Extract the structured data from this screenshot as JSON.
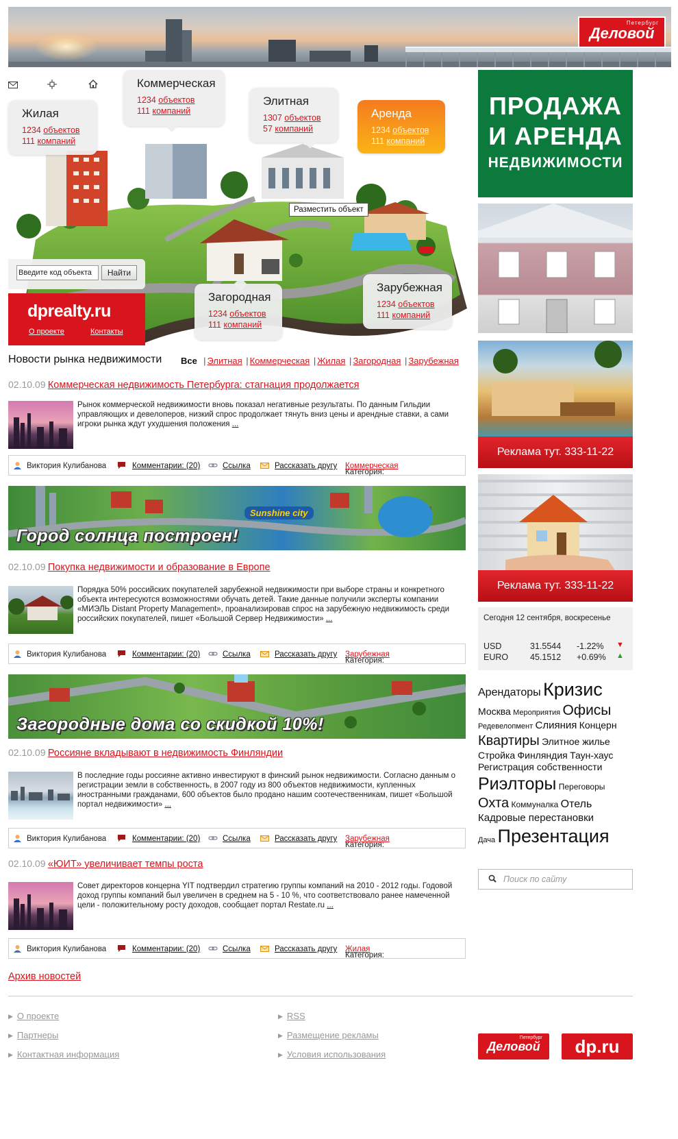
{
  "header": {
    "logo_small": "Петербург",
    "logo_big": "Деловой"
  },
  "top_icons": [
    "mail-icon",
    "sitemap-icon",
    "home-icon"
  ],
  "categories": {
    "residential": {
      "title": "Жилая",
      "objects_count": "1234",
      "objects_label": "объектов",
      "companies_count": "111",
      "companies_label": "компаний"
    },
    "commercial": {
      "title": "Коммерческая",
      "objects_count": "1234",
      "objects_label": "объектов",
      "companies_count": "111",
      "companies_label": "компаний"
    },
    "elite": {
      "title": "Элитная",
      "objects_count": "1307",
      "objects_label": "объектов",
      "companies_count": "57",
      "companies_label": "компаний"
    },
    "rent": {
      "title": "Аренда",
      "objects_count": "1234",
      "objects_label": "объектов",
      "companies_count": "111",
      "companies_label": "компаний"
    },
    "country": {
      "title": "Загородная",
      "objects_count": "1234",
      "objects_label": "объектов",
      "companies_count": "111",
      "companies_label": "компаний"
    },
    "foreign": {
      "title": "Зарубежная",
      "objects_count": "1234",
      "objects_label": "объектов",
      "companies_count": "111",
      "companies_label": "компаний"
    }
  },
  "place_object_button": "Разместить объект",
  "code_search": {
    "placeholder": "Введите код объекта",
    "button": "Найти"
  },
  "site_logo": {
    "name": "dprealty.ru",
    "about": "О проекте",
    "contacts": "Контакты"
  },
  "news_section": {
    "title": "Новости рынка недвижимости",
    "filter_all": "Все",
    "filters": [
      "Элитная",
      "Коммерческая",
      "Жилая",
      "Загородная",
      "Зарубежная"
    ]
  },
  "news": [
    {
      "date": "02.10.09",
      "title": "Коммерческая недвижимость Петербурга: стагнация продолжается",
      "text": "Рынок коммерческой недвижимости вновь показал негативные результаты. По данным Гильдии управляющих и девелоперов, низкий спрос продолжает тянуть вниз цены и арендные ставки, а сами игроки рынка ждут ухудшения положения",
      "more": "...",
      "author": "Виктория Кулибанова",
      "comments": "Комментарии: (20)",
      "link": "Ссылка",
      "tell_friend": "Рассказать другу",
      "category_label": "Категория:",
      "category": "Коммерческая"
    },
    {
      "date": "02.10.09",
      "title": "Покупка недвижимости и образование в Европе",
      "text": "Порядка 50% российских покупателей зарубежной недвижимости при выборе страны и конкретного объекта интересуются возможностями обучать детей. Такие данные получили эксперты компании «МИЭЛЬ Distant Property Management», проанализировав спрос на зарубежную недвижимость среди российских покупателей, пишет «Большой Сервер Недвижимости»",
      "more": "...",
      "author": "Виктория Кулибанова",
      "comments": "Комментарии: (20)",
      "link": "Ссылка",
      "tell_friend": "Рассказать другу",
      "category_label": "Категория:",
      "category": "Зарубежная"
    },
    {
      "date": "02.10.09",
      "title": "Россияне вкладывают в недвижимость Финляндии",
      "text": "В последние годы россияне активно инвестируют в финский рынок недвижимости. Согласно данным о регистрации земли в собственность, в 2007 году из 800 объектов недвижимости, купленных иностранными гражданами, 600 объектов было продано нашим соотечественникам, пишет «Большой портал недвижимости»",
      "more": "...",
      "author": "Виктория Кулибанова",
      "comments": "Комментарии: (20)",
      "link": "Ссылка",
      "tell_friend": "Рассказать другу",
      "category_label": "Категория:",
      "category": "Зарубежная"
    },
    {
      "date": "02.10.09",
      "title": "«ЮИТ» увеличивает темпы роста",
      "text": "Совет директоров концерна YIT подтвердил стратегию группы компаний на 2010 - 2012 годы. Годовой доход группы компаний был увеличен в среднем на 5 - 10 %, что соответствовало ранее намеченной цели - положительному росту доходов, сообщает портал Restate.ru",
      "more": "...",
      "author": "Виктория Кулибанова",
      "comments": "Комментарии: (20)",
      "link": "Ссылка",
      "tell_friend": "Рассказать другу",
      "category_label": "Категория:",
      "category": "Жилая"
    }
  ],
  "banners": {
    "banner1": "Город солнца построен!",
    "banner1_sign": "Sunshine city",
    "banner2": "Загородные дома со скидкой 10%!"
  },
  "archive_link": "Архив новостей",
  "right_ads": {
    "green": {
      "line1": "ПРОДАЖА",
      "line2": "И АРЕНДА",
      "line3": "НЕДВИЖИМОСТИ"
    },
    "ad2": "Реклама тут. 333-11-22",
    "ad3": "Реклама тут. 333-11-22"
  },
  "currency": {
    "date": "Сегодня 12 сентября, воскресенье",
    "rows": [
      {
        "name": "USD",
        "value": "31.5544",
        "change": "-1.22%",
        "direction": "down",
        "color": "#d8141c"
      },
      {
        "name": "EURO",
        "value": "45.1512",
        "change": "+0.69%",
        "direction": "up",
        "color": "#2a9a2a"
      }
    ]
  },
  "tags": [
    [
      "Арендаторы",
      "Кризис"
    ],
    [
      "Москва",
      "Мероприятия",
      "Офисы"
    ],
    [
      "Редевелопмент",
      "Слияния",
      "Концерн"
    ],
    [
      "Квартиры",
      "Элитное жилье"
    ],
    [
      "Стройка",
      "Финляндия",
      "Таун-хаус"
    ],
    [
      "Регистрация собственности"
    ],
    [
      "Риэлторы",
      "Переговоры"
    ],
    [
      "Охта",
      "Коммуналка",
      "Отель"
    ],
    [
      "Кадровые перестановки"
    ],
    [
      "Дача",
      "Презентация"
    ]
  ],
  "site_search": {
    "placeholder": "Поиск по сайту"
  },
  "footer": {
    "left": [
      "О проекте",
      "Партнеры",
      "Контактная информация"
    ],
    "right": [
      "RSS",
      "Размещение рекламы",
      "Условия использования"
    ],
    "logo1_small": "Петербург",
    "logo1": "Деловой",
    "logo2": "dp.ru"
  },
  "colors": {
    "accent": "#d8141c",
    "green_ad": "#0d7a3d",
    "orange": "#f47b20"
  }
}
